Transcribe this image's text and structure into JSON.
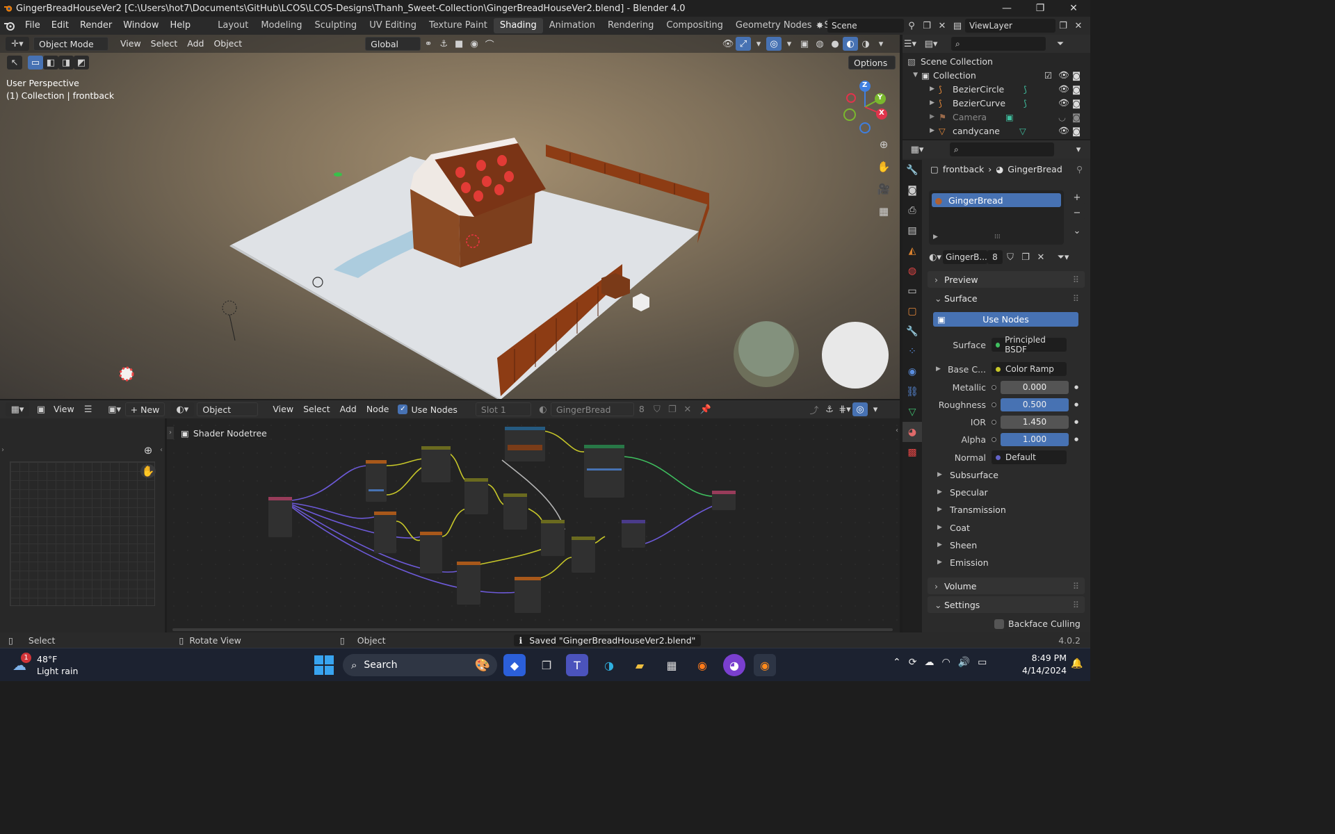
{
  "window": {
    "title": "GingerBreadHouseVer2 [C:\\Users\\hot7\\Documents\\GitHub\\LCOS\\LCOS-Designs\\Thanh_Sweet-Collection\\GingerBreadHouseVer2.blend] - Blender 4.0",
    "minimize": "—",
    "maximize": "❐",
    "close": "✕"
  },
  "menubar": {
    "menus": [
      "File",
      "Edit",
      "Render",
      "Window",
      "Help"
    ],
    "workspaces": [
      "Layout",
      "Modeling",
      "Sculpting",
      "UV Editing",
      "Texture Paint",
      "Shading",
      "Animation",
      "Rendering",
      "Compositing",
      "Geometry Nodes",
      "Scripting"
    ],
    "active_workspace": "Shading",
    "add_workspace": "+",
    "scene": "Scene",
    "view_layer": "ViewLayer"
  },
  "viewport": {
    "mode": "Object Mode",
    "menus": [
      "View",
      "Select",
      "Add",
      "Object"
    ],
    "transform": "Global",
    "options": "Options",
    "info_line1": "User Perspective",
    "info_line2": "(1) Collection | frontback",
    "gizmo": {
      "x": "X",
      "y": "Y",
      "z": "Z"
    }
  },
  "outliner": {
    "root": "Scene Collection",
    "collection": "Collection",
    "items": [
      {
        "name": "BezierCircle",
        "type": "curve"
      },
      {
        "name": "BezierCurve",
        "type": "curve"
      },
      {
        "name": "Camera",
        "type": "camera"
      },
      {
        "name": "candycane",
        "type": "mesh"
      }
    ]
  },
  "properties": {
    "breadcrumb_object": "frontback",
    "breadcrumb_material": "GingerBread",
    "material_slot": "GingerBread",
    "material_name": "GingerB...",
    "users": "8",
    "panels": {
      "preview": "Preview",
      "surface": "Surface",
      "volume": "Volume",
      "settings": "Settings"
    },
    "use_nodes": "Use Nodes",
    "fields": [
      {
        "label": "Surface",
        "value": "Principled BSDF",
        "dot": "#3fbf5f"
      },
      {
        "label": "Base C...",
        "value": "Color Ramp",
        "dot": "#c7c729"
      },
      {
        "label": "Metallic",
        "value": "0.000",
        "dot": "#a1a1a1"
      },
      {
        "label": "Roughness",
        "value": "0.500",
        "dot": "#a1a1a1"
      },
      {
        "label": "IOR",
        "value": "1.450",
        "dot": "#a1a1a1"
      },
      {
        "label": "Alpha",
        "value": "1.000",
        "dot": "#a1a1a1"
      },
      {
        "label": "Normal",
        "value": "Default",
        "dot": "#6363c7"
      }
    ],
    "subpanels": [
      "Subsurface",
      "Specular",
      "Transmission",
      "Coat",
      "Sheen",
      "Emission"
    ],
    "backface": "Backface Culling"
  },
  "node_editor": {
    "view": "View",
    "new": "New",
    "object": "Object",
    "menus": [
      "View",
      "Select",
      "Add",
      "Node"
    ],
    "use_nodes": "Use Nodes",
    "slot": "Slot 1",
    "material": "GingerBread",
    "users": "8",
    "tree_name": "Shader Nodetree"
  },
  "statusbar": {
    "select": "Select",
    "rotate": "Rotate View",
    "object": "Object",
    "message": "Saved \"GingerBreadHouseVer2.blend\"",
    "version": "4.0.2"
  },
  "taskbar": {
    "weather_temp": "48°F",
    "weather_desc": "Light rain",
    "weather_badge": "1",
    "search": "Search",
    "time": "8:49 PM",
    "date": "4/14/2024"
  },
  "colors": {
    "accent": "#4772b3",
    "active_tab": "#3d3d3d",
    "panel_bg": "#2b2b2b",
    "gingerbread": "#8a4a22",
    "frosting": "#ece8e4"
  }
}
